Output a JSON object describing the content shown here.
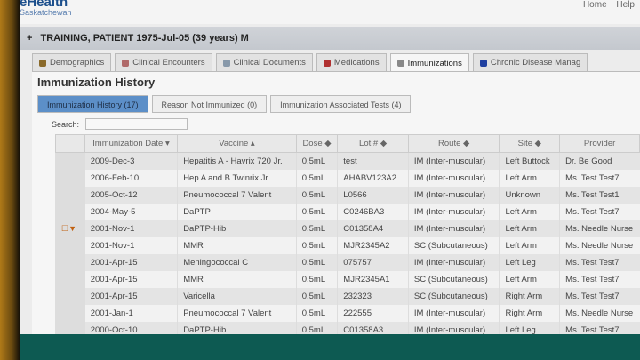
{
  "app": {
    "logo_line1": "eHealth",
    "logo_line2": "Saskatchewan",
    "links": [
      "Home",
      "Help"
    ]
  },
  "patient": {
    "expand": "+",
    "label": "TRAINING, PATIENT 1975-Jul-05 (39 years) M"
  },
  "tabs": [
    {
      "label": "Demographics",
      "color": "#8a6a2a"
    },
    {
      "label": "Clinical Encounters",
      "color": "#b06a6a"
    },
    {
      "label": "Clinical Documents",
      "color": "#8899aa"
    },
    {
      "label": "Medications",
      "color": "#b03030"
    },
    {
      "label": "Immunizations",
      "color": "#888",
      "active": true
    },
    {
      "label": "Chronic Disease Manag",
      "color": "#2040a0"
    }
  ],
  "page_title": "Immunization History",
  "subtabs": [
    "Immunization History (17)",
    "Reason Not Immunized (0)",
    "Immunization Associated Tests (4)"
  ],
  "search": {
    "label": "Search:",
    "value": ""
  },
  "table": {
    "headers": [
      "Immunization Date ▾",
      "Vaccine ▴",
      "Dose ◆",
      "Lot # ◆",
      "Route ◆",
      "Site ◆",
      "Provider"
    ],
    "rows": [
      [
        "2009-Dec-3",
        "Hepatitis A - Havrix 720 Jr.",
        "0.5mL",
        "test",
        "IM (Inter-muscular)",
        "Left Buttock",
        "Dr. Be Good"
      ],
      [
        "2006-Feb-10",
        "Hep A and B Twinrix Jr.",
        "0.5mL",
        "AHABV123A2",
        "IM (Inter-muscular)",
        "Left Arm",
        "Ms. Test Test7"
      ],
      [
        "2005-Oct-12",
        "Pneumococcal 7 Valent",
        "0.5mL",
        "L0566",
        "IM (Inter-muscular)",
        "Unknown",
        "Ms. Test Test1"
      ],
      [
        "2004-May-5",
        "DaPTP",
        "0.5mL",
        "C0246BA3",
        "IM (Inter-muscular)",
        "Left Arm",
        "Ms. Test Test7"
      ],
      [
        "2001-Nov-1",
        "DaPTP-Hib",
        "0.5mL",
        "C01358A4",
        "IM (Inter-muscular)",
        "Left Arm",
        "Ms. Needle Nurse"
      ],
      [
        "2001-Nov-1",
        "MMR",
        "0.5mL",
        "MJR2345A2",
        "SC (Subcutaneous)",
        "Left Arm",
        "Ms. Needle Nurse"
      ],
      [
        "2001-Apr-15",
        "Meningococcal C",
        "0.5mL",
        "075757",
        "IM (Inter-muscular)",
        "Left Leg",
        "Ms. Test Test7"
      ],
      [
        "2001-Apr-15",
        "MMR",
        "0.5mL",
        "MJR2345A1",
        "SC (Subcutaneous)",
        "Left Arm",
        "Ms. Test Test7"
      ],
      [
        "2001-Apr-15",
        "Varicella",
        "0.5mL",
        "232323",
        "SC (Subcutaneous)",
        "Right Arm",
        "Ms. Test Test7"
      ],
      [
        "2001-Jan-1",
        "Pneumococcal 7 Valent",
        "0.5mL",
        "222555",
        "IM (Inter-muscular)",
        "Right Arm",
        "Ms. Needle Nurse"
      ],
      [
        "2000-Oct-10",
        "DaPTP-Hib",
        "0.5mL",
        "C01358A3",
        "IM (Inter-muscular)",
        "Left Leg",
        "Ms. Test Test7"
      ]
    ],
    "expand_row": 4,
    "expand_icons": "☐▼"
  }
}
